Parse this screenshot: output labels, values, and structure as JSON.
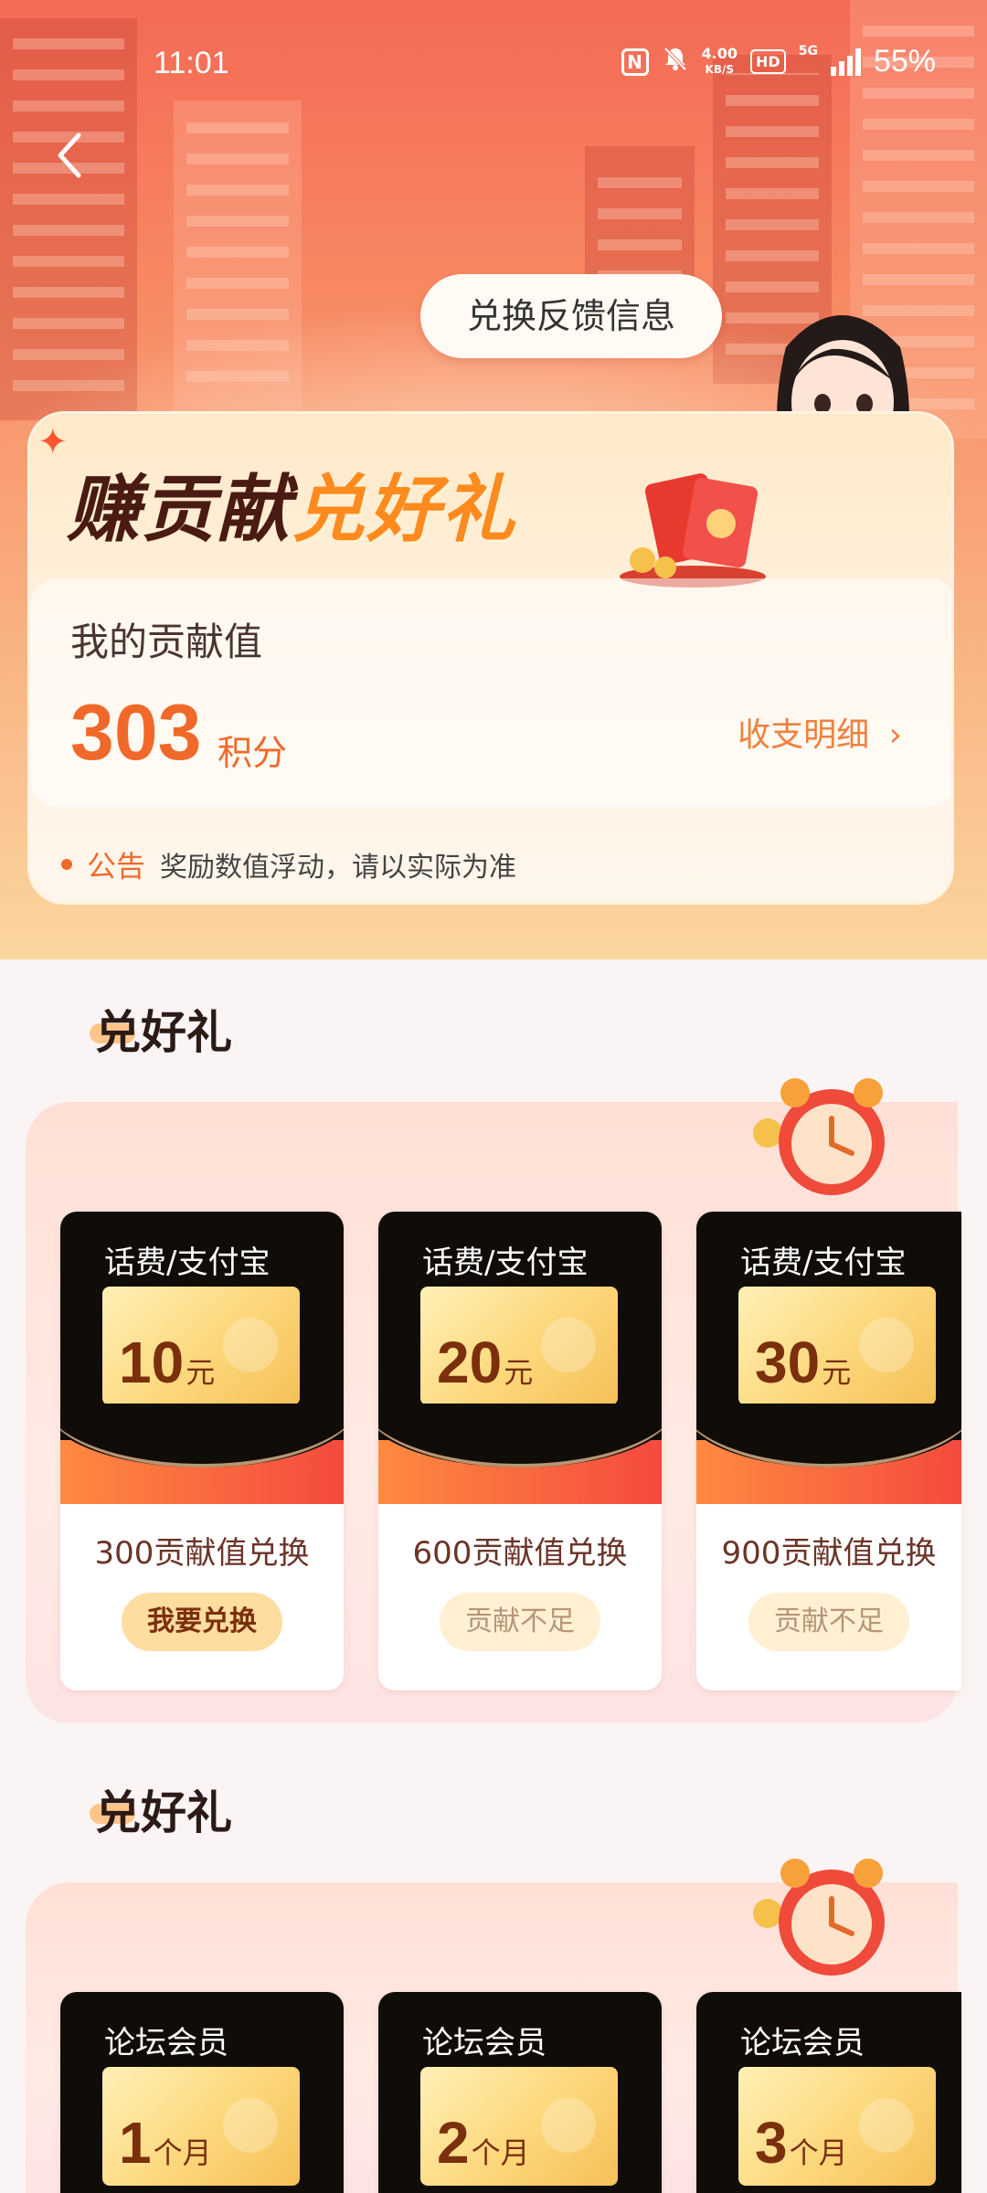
{
  "status_bar": {
    "time": "11:01",
    "speed_value": "4.00",
    "speed_unit": "KB/S",
    "hd": "HD",
    "network": "5G",
    "battery": "55%"
  },
  "header": {
    "feedback_label": "兑换反馈信息"
  },
  "banner": {
    "title_part1": "赚贡献",
    "title_part2": "兑好礼"
  },
  "contribution": {
    "label": "我的贡献值",
    "value": "303",
    "unit": "积分",
    "details_link": "收支明细",
    "details_chevron": "›"
  },
  "notice": {
    "tag": "公告",
    "text": "奖励数值浮动，请以实际为准"
  },
  "sections": [
    {
      "title": "兑好礼",
      "items": [
        {
          "type": "话费/支付宝",
          "amount": "10",
          "unit": "元",
          "cost": "300贡献值兑换",
          "button": "我要兑换"
        },
        {
          "type": "话费/支付宝",
          "amount": "20",
          "unit": "元",
          "cost": "600贡献值兑换",
          "button": "贡献不足"
        },
        {
          "type": "话费/支付宝",
          "amount": "30",
          "unit": "元",
          "cost": "900贡献值兑换",
          "button": "贡献不足"
        }
      ]
    },
    {
      "title": "兑好礼",
      "items": [
        {
          "type": "论坛会员",
          "amount": "1",
          "unit": "个月"
        },
        {
          "type": "论坛会员",
          "amount": "2",
          "unit": "个月"
        },
        {
          "type": "论坛会员",
          "amount": "3",
          "unit": "个月"
        }
      ]
    }
  ],
  "colors": {
    "accent": "#f0692a",
    "card_dark": "#100c08",
    "button_active": "#ffdca0"
  }
}
